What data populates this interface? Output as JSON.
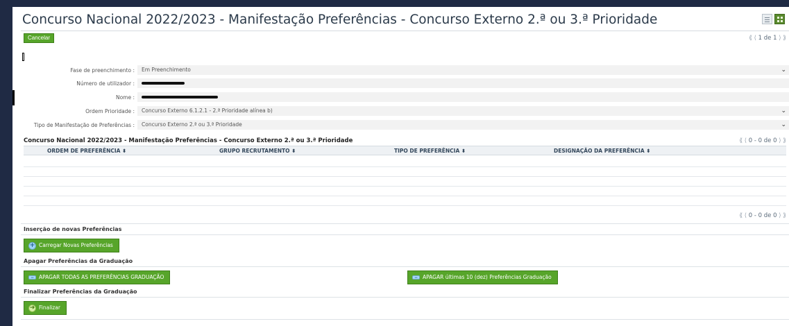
{
  "header": {
    "title": "Concurso Nacional 2022/2023 - Manifestação Preferências - Concurso Externo 2.ª ou 3.ª Prioridade",
    "cancel_label": "Cancelar",
    "pager": {
      "first": "⟪",
      "prev": "⟨",
      "text": "1 de 1",
      "next": "⟩",
      "last": "⟫"
    }
  },
  "form": {
    "fields": [
      {
        "label": "Fase de preenchimento :",
        "value": "Em Preenchimento",
        "dropdown": true
      },
      {
        "label": "Número de utilizador :",
        "value": "",
        "redacted": true
      },
      {
        "label": "Nome :",
        "value": "",
        "redacted": true
      },
      {
        "label": "Ordem Prioridade :",
        "value": "Concurso Externo 6.1.2.1 - 2.ª Prioridade alínea b)",
        "dropdown": true
      },
      {
        "label": "Tipo de Manifestação de Preferências :",
        "value": "Concurso Externo 2.ª ou 3.ª Prioridade",
        "dropdown": true
      }
    ]
  },
  "grid": {
    "title": "Concurso Nacional 2022/2023 - Manifestação Preferências - Concurso Externo 2.ª ou 3.ª Prioridade",
    "pager_text": "0 - 0 de 0",
    "columns": [
      "ORDEM DE PREFERÊNCIA ⬍",
      "GRUPO RECRUTAMENTO ⬍",
      "TIPO DE PREFERÊNCIA ⬍",
      "DESIGNAÇÃO DA PREFERÊNCIA ⬍"
    ]
  },
  "sections": {
    "insert_title": "Inserção de novas Preferências",
    "load_button": "Carregar Novas Preferências",
    "delete_title": "Apagar Preferências da Graduação",
    "delete_all_button": "APAGAR TODAS AS PREFERÊNCIAS GRADUAÇÃO",
    "delete_last_button": "APAGAR últimas 10 (dez) Preferências Graduação",
    "finalize_title": "Finalizar Preferências da Graduação",
    "finalize_button": "Finalizar"
  },
  "colors": {
    "button_green": "#57a52a",
    "title_text": "#2b3a4a",
    "frame_bg": "#1f2a44"
  }
}
